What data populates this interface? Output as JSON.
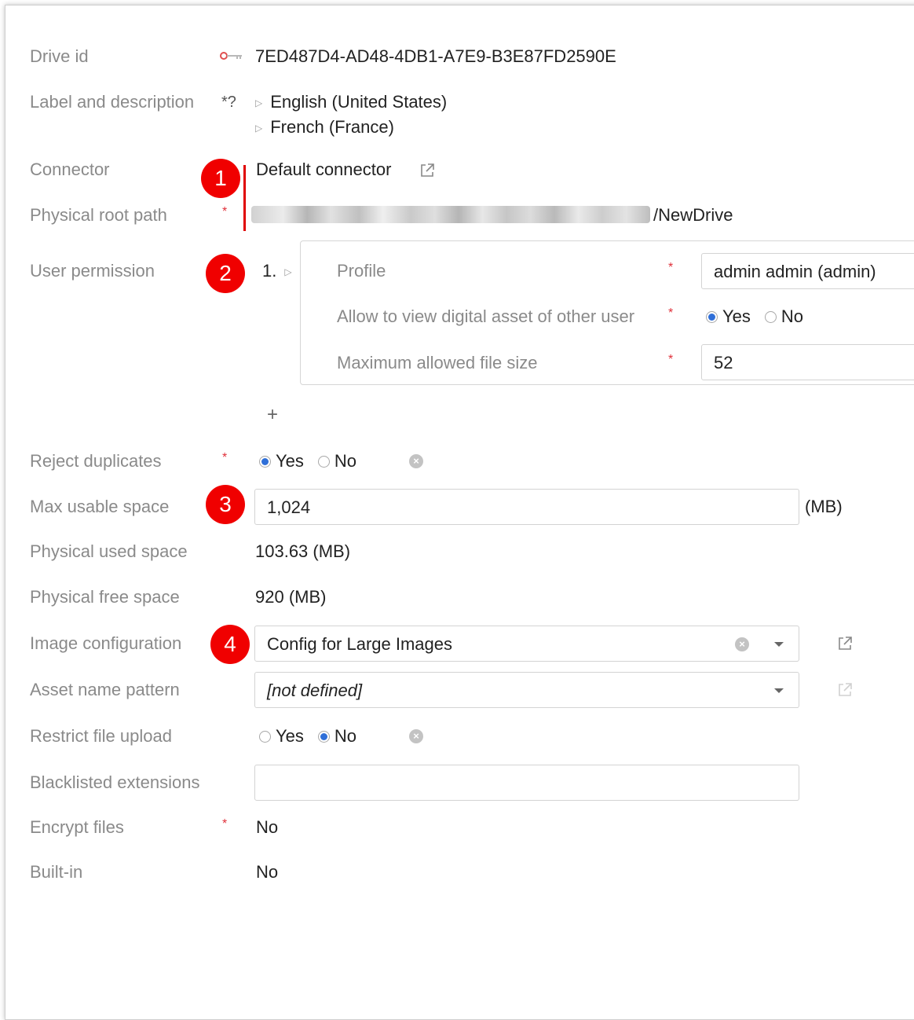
{
  "fields": {
    "drive_id": {
      "label": "Drive id",
      "value": "7ED487D4-AD48-4DB1-A7E9-B3E87FD2590E"
    },
    "label_description": {
      "label": "Label and description",
      "req_mark": "*?",
      "languages": [
        "English (United States)",
        "French (France)"
      ]
    },
    "connector": {
      "label": "Connector",
      "value": "Default connector"
    },
    "physical_root_path": {
      "label": "Physical root path",
      "value_suffix": "/NewDrive"
    },
    "user_permission": {
      "label": "User permission",
      "index": "1.",
      "profile_label": "Profile",
      "profile_value": "admin admin (admin)",
      "allow_label": "Allow to view digital asset of other user",
      "allow_yes": "Yes",
      "allow_no": "No",
      "max_size_label": "Maximum allowed file size",
      "max_size_value": "52",
      "add_symbol": "+"
    },
    "reject_duplicates": {
      "label": "Reject duplicates",
      "yes": "Yes",
      "no": "No"
    },
    "max_usable_space": {
      "label": "Max usable space",
      "value": "1,024",
      "unit": "(MB)"
    },
    "physical_used_space": {
      "label": "Physical used space",
      "value": "103.63 (MB)"
    },
    "physical_free_space": {
      "label": "Physical free space",
      "value": "920 (MB)"
    },
    "image_configuration": {
      "label": "Image configuration",
      "value": "Config for Large Images"
    },
    "asset_name_pattern": {
      "label": "Asset name pattern",
      "value": "[not defined]"
    },
    "restrict_file_upload": {
      "label": "Restrict file upload",
      "yes": "Yes",
      "no": "No"
    },
    "blacklisted_extensions": {
      "label": "Blacklisted extensions",
      "value": ""
    },
    "encrypt_files": {
      "label": "Encrypt files",
      "value": "No"
    },
    "built_in": {
      "label": "Built-in",
      "value": "No"
    }
  },
  "required_mark": "*",
  "badges": [
    "1",
    "2",
    "3",
    "4"
  ],
  "colors": {
    "accent": "#2f6fd8",
    "badge": "#f00000",
    "label": "#8a8a8a",
    "required": "#e0303a"
  },
  "icons": [
    "key-icon",
    "external-link-icon",
    "clear-icon",
    "dropdown-caret-icon",
    "expand-triangle-icon",
    "add-icon"
  ]
}
